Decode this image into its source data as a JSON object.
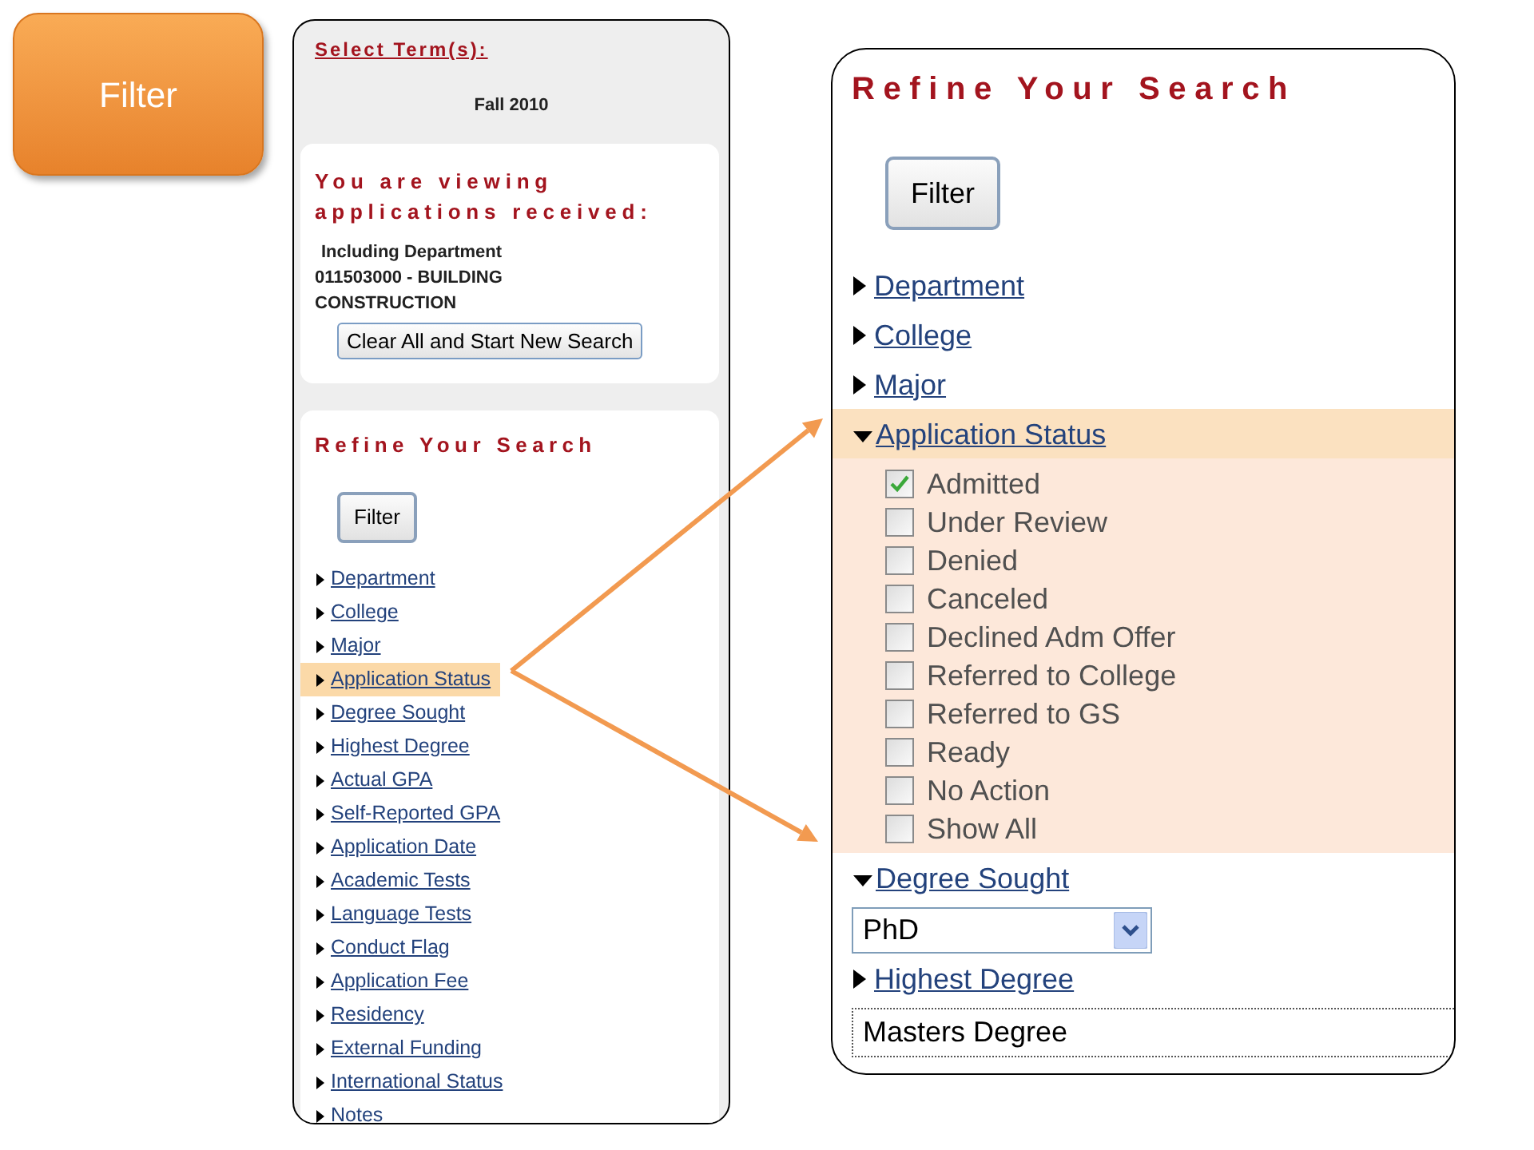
{
  "slide_label": {
    "text": "Filter"
  },
  "left_panel": {
    "term_heading": "Select Term(s):",
    "term": "Fall 2010",
    "viewing_heading": "You are viewing applications received:",
    "viewing_scope": "Including Department",
    "viewing_department": "011503000 - BUILDING CONSTRUCTION",
    "clear_button": "Clear All and Start New Search",
    "refine_heading": "Refine Your Search",
    "filter_button": "Filter",
    "filters": [
      {
        "label": "Department",
        "expanded": false,
        "highlighted": false
      },
      {
        "label": "College",
        "expanded": false,
        "highlighted": false
      },
      {
        "label": "Major",
        "expanded": false,
        "highlighted": false
      },
      {
        "label": "Application Status",
        "expanded": false,
        "highlighted": true
      },
      {
        "label": "Degree Sought",
        "expanded": false,
        "highlighted": false
      },
      {
        "label": "Highest Degree",
        "expanded": false,
        "highlighted": false
      },
      {
        "label": "Actual GPA",
        "expanded": false,
        "highlighted": false
      },
      {
        "label": "Self-Reported GPA",
        "expanded": false,
        "highlighted": false
      },
      {
        "label": "Application Date",
        "expanded": false,
        "highlighted": false
      },
      {
        "label": "Academic Tests",
        "expanded": false,
        "highlighted": false
      },
      {
        "label": "Language Tests",
        "expanded": false,
        "highlighted": false
      },
      {
        "label": "Conduct Flag",
        "expanded": false,
        "highlighted": false
      },
      {
        "label": "Application Fee",
        "expanded": false,
        "highlighted": false
      },
      {
        "label": "Residency",
        "expanded": false,
        "highlighted": false
      },
      {
        "label": "External Funding",
        "expanded": false,
        "highlighted": false
      },
      {
        "label": "International Status",
        "expanded": false,
        "highlighted": false
      },
      {
        "label": "Notes",
        "expanded": false,
        "highlighted": false
      }
    ]
  },
  "right_panel": {
    "refine_heading": "Refine Your Search",
    "filter_button": "Filter",
    "filters": [
      {
        "kind": "link",
        "label": "Department",
        "expanded": false,
        "highlighted": false
      },
      {
        "kind": "link",
        "label": "College",
        "expanded": false,
        "highlighted": false
      },
      {
        "kind": "link",
        "label": "Major",
        "expanded": false,
        "highlighted": false
      },
      {
        "kind": "checklist",
        "label": "Application Status",
        "expanded": true,
        "highlighted": true,
        "options": [
          {
            "label": "Admitted",
            "checked": true
          },
          {
            "label": "Under Review",
            "checked": false
          },
          {
            "label": "Denied",
            "checked": false
          },
          {
            "label": "Canceled",
            "checked": false
          },
          {
            "label": "Declined Adm Offer",
            "checked": false
          },
          {
            "label": "Referred to College",
            "checked": false
          },
          {
            "label": "Referred to GS",
            "checked": false
          },
          {
            "label": "Ready",
            "checked": false
          },
          {
            "label": "No Action",
            "checked": false
          },
          {
            "label": "Show All",
            "checked": false
          }
        ]
      },
      {
        "kind": "dropdown",
        "label": "Degree Sought",
        "expanded": true,
        "highlighted": false,
        "value": "PhD"
      },
      {
        "kind": "textbox",
        "label": "Highest Degree",
        "expanded": false,
        "highlighted": false,
        "value": "Masters Degree"
      }
    ]
  }
}
